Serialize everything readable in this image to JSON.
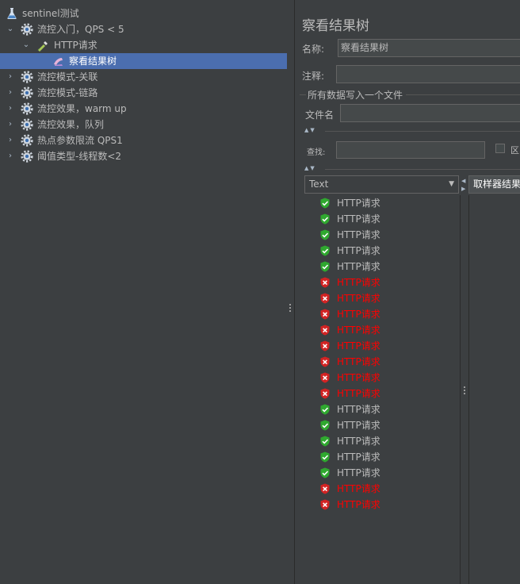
{
  "tree": {
    "items": [
      {
        "label": "sentinel测试",
        "icon": "flask-icon",
        "depth": 0,
        "chevron": ""
      },
      {
        "label": "流控入门，QPS < 5",
        "icon": "gear-icon",
        "depth": 1,
        "chevron": "expanded"
      },
      {
        "label": "HTTP请求",
        "icon": "pipette-icon",
        "depth": 2,
        "chevron": "expanded"
      },
      {
        "label": "察看结果树",
        "icon": "listener-icon",
        "depth": 3,
        "chevron": "",
        "selected": true
      },
      {
        "label": "流控模式-关联",
        "icon": "gear-icon",
        "depth": 1,
        "chevron": "collapsed"
      },
      {
        "label": "流控模式-链路",
        "icon": "gear-icon",
        "depth": 1,
        "chevron": "collapsed"
      },
      {
        "label": "流控效果，warm up",
        "icon": "gear-icon",
        "depth": 1,
        "chevron": "collapsed"
      },
      {
        "label": "流控效果，队列",
        "icon": "gear-icon",
        "depth": 1,
        "chevron": "collapsed"
      },
      {
        "label": "热点参数限流 QPS1",
        "icon": "gear-icon",
        "depth": 1,
        "chevron": "collapsed"
      },
      {
        "label": "阈值类型-线程数<2",
        "icon": "gear-icon",
        "depth": 1,
        "chevron": "collapsed"
      }
    ]
  },
  "panel": {
    "title": "察看结果树",
    "name_label": "名称:",
    "name_value": "察看结果树",
    "comment_label": "注释:",
    "comment_value": "",
    "file_section": "所有数据写入一个文件",
    "filename_label": "文件名",
    "filename_value": "",
    "search_label": "查找:",
    "search_value": "",
    "case_label": "区",
    "renderer": "Text",
    "detail_tab": "取样器结果"
  },
  "results": [
    {
      "label": "HTTP请求",
      "status": "success"
    },
    {
      "label": "HTTP请求",
      "status": "success"
    },
    {
      "label": "HTTP请求",
      "status": "success"
    },
    {
      "label": "HTTP请求",
      "status": "success"
    },
    {
      "label": "HTTP请求",
      "status": "success"
    },
    {
      "label": "HTTP请求",
      "status": "error"
    },
    {
      "label": "HTTP请求",
      "status": "error"
    },
    {
      "label": "HTTP请求",
      "status": "error"
    },
    {
      "label": "HTTP请求",
      "status": "error"
    },
    {
      "label": "HTTP请求",
      "status": "error"
    },
    {
      "label": "HTTP请求",
      "status": "error"
    },
    {
      "label": "HTTP请求",
      "status": "error"
    },
    {
      "label": "HTTP请求",
      "status": "error"
    },
    {
      "label": "HTTP请求",
      "status": "success"
    },
    {
      "label": "HTTP请求",
      "status": "success"
    },
    {
      "label": "HTTP请求",
      "status": "success"
    },
    {
      "label": "HTTP请求",
      "status": "success"
    },
    {
      "label": "HTTP请求",
      "status": "success"
    },
    {
      "label": "HTTP请求",
      "status": "error"
    },
    {
      "label": "HTTP请求",
      "status": "error"
    }
  ],
  "colors": {
    "background": "#3c3f41",
    "selection": "#4b6eaf",
    "success": "#2fa82f",
    "error": "#d22323",
    "error_text": "#ff0000"
  }
}
